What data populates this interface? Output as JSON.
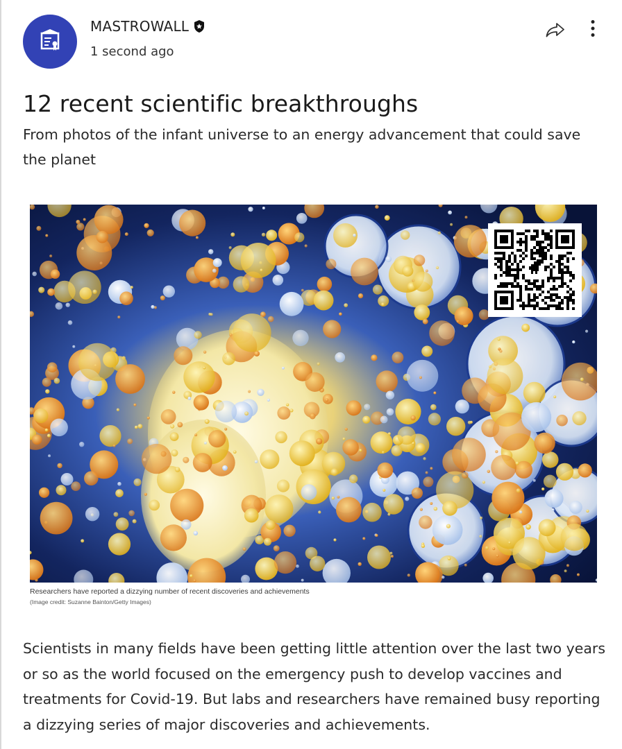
{
  "post": {
    "author": "MASTROWALL",
    "timestamp": "1 second ago",
    "verified_icon": "verified-badge-icon",
    "avatar_icon": "certificate-icon",
    "share_icon": "share-arrow-icon",
    "more_icon": "more-vertical-icon"
  },
  "article": {
    "title": "12 recent scientific breakthroughs",
    "subtitle": "From photos of the infant universe to an energy advancement that could save the planet",
    "image_caption": "Researchers have reported a dizzying number of recent discoveries and achievements",
    "image_credit": "(Image credit: Suzanne Bainton/Getty Images)",
    "body": "Scientists in many fields have been getting little attention over the last two years or so as the world focused on the emergency push to develop vaccines and treatments for Covid-19. But labs and researchers have remained busy reporting a dizzying series of major discoveries and achievements."
  },
  "colors": {
    "avatar_bg": "#3242b5",
    "text": "#1f1f1f",
    "image_deep_blue": "#0c1a4a",
    "bubble_orange": "#e8961e",
    "bubble_cream": "#fbf3c8"
  }
}
